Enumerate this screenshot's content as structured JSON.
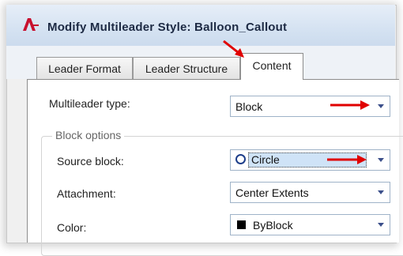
{
  "window": {
    "app_icon": "autocad-logo-icon",
    "title": "Modify Multileader Style: Balloon_Callout"
  },
  "tabs": [
    {
      "label": "Leader Format",
      "active": false
    },
    {
      "label": "Leader Structure",
      "active": false
    },
    {
      "label": "Content",
      "active": true
    }
  ],
  "content": {
    "multileader_type": {
      "label": "Multileader type:",
      "value": "Block"
    },
    "block_options": {
      "group_label": "Block options",
      "source_block": {
        "label": "Source block:",
        "value": "Circle",
        "icon": "circle-icon"
      },
      "attachment": {
        "label": "Attachment:",
        "value": "Center Extents"
      },
      "color": {
        "label": "Color:",
        "value": "ByBlock",
        "swatch": "#000000"
      }
    }
  },
  "annotations": {
    "arrow_color": "#e00000"
  }
}
